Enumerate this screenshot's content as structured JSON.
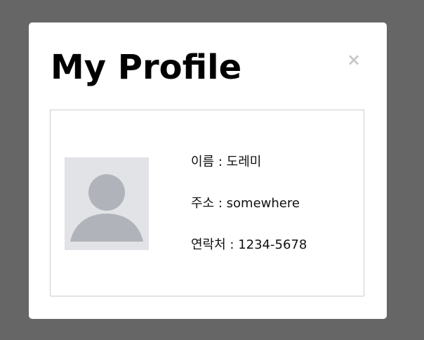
{
  "modal": {
    "title": "My Profile",
    "close_label": "×"
  },
  "profile": {
    "avatar_icon": "user-placeholder-icon",
    "fields": [
      {
        "label": "이름",
        "separator": " : ",
        "value": "도레미"
      },
      {
        "label": "주소",
        "separator": " : ",
        "value": "somewhere"
      },
      {
        "label": "연락처",
        "separator": " : ",
        "value": "1234-5678"
      }
    ]
  },
  "colors": {
    "backdrop": "#666666",
    "modal_bg": "#ffffff",
    "close_icon": "#c8c8c8",
    "card_border": "#cccccc",
    "avatar_bg": "#e1e3e6",
    "avatar_figure": "#b0b4ba"
  }
}
